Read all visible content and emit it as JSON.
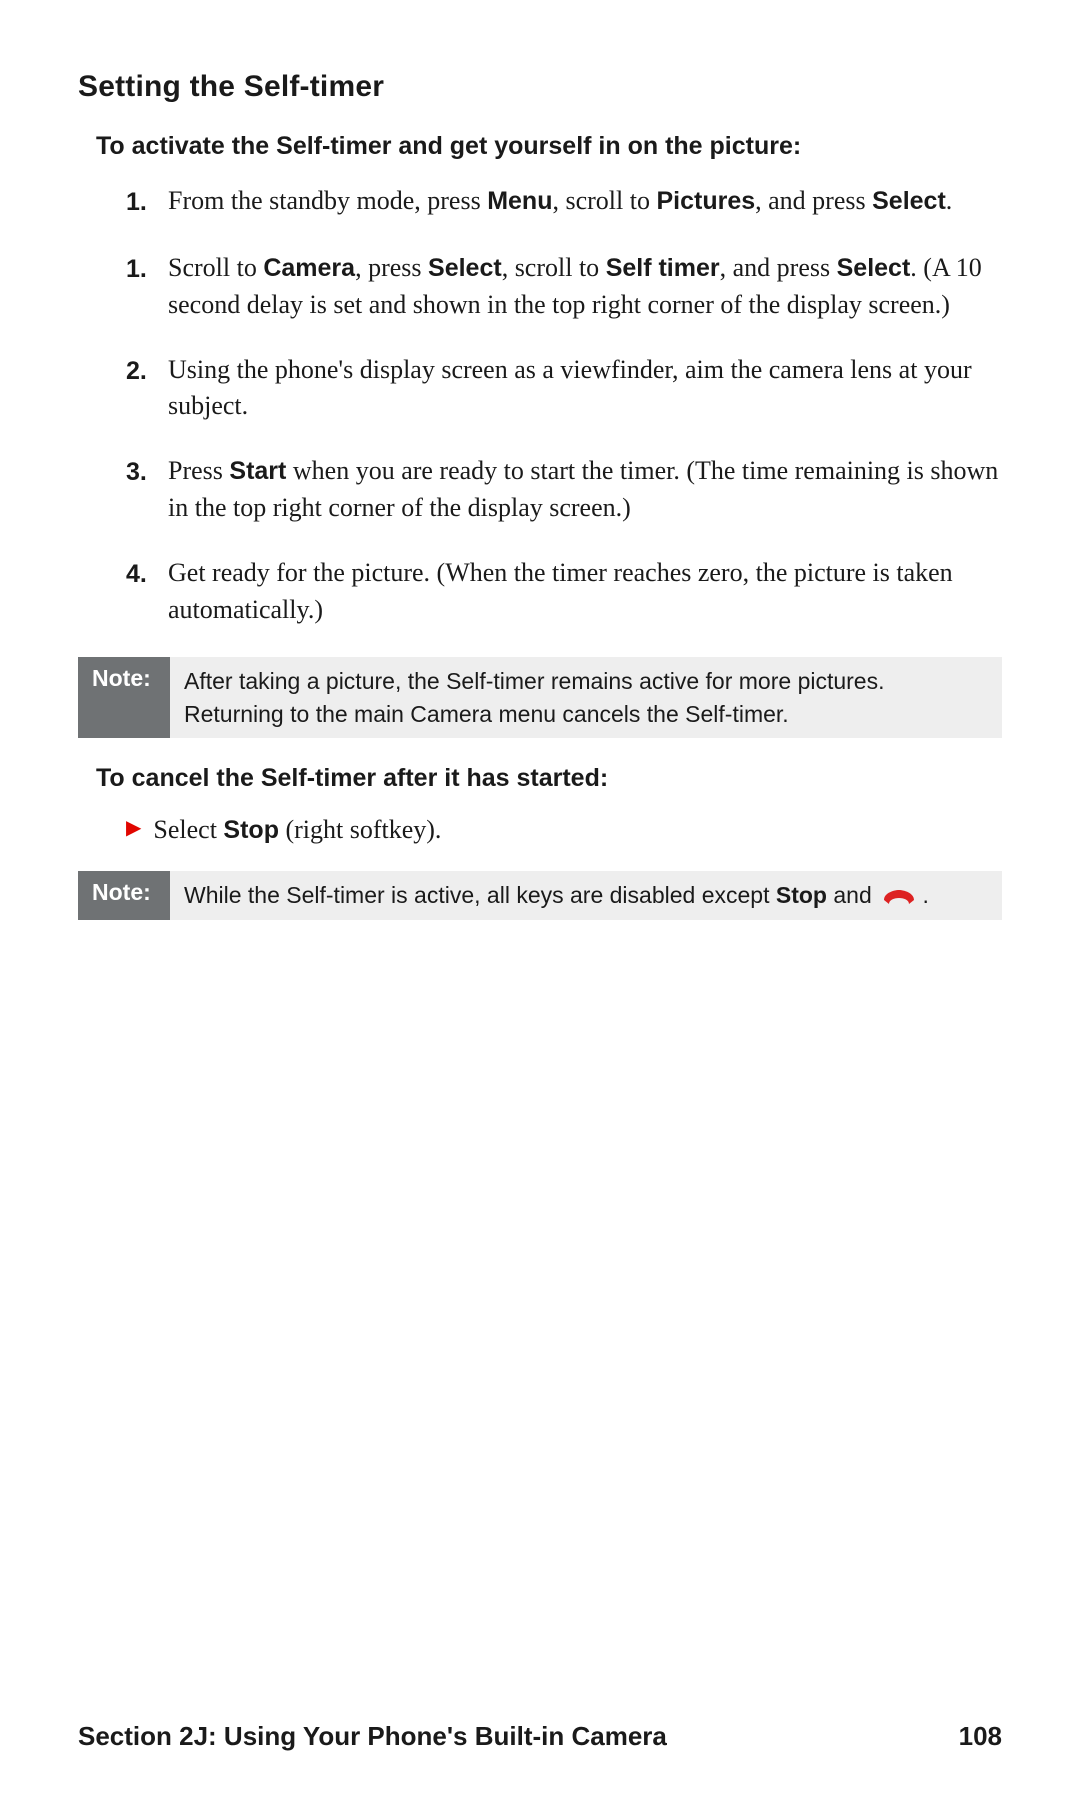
{
  "heading": "Setting the Self-timer",
  "intro": "To activate the Self-timer and get yourself in on the picture:",
  "steps": [
    {
      "num": "1.",
      "parts": [
        {
          "t": "From the standby mode, press "
        },
        {
          "t": "Menu",
          "b": true
        },
        {
          "t": ", scroll to "
        },
        {
          "t": "Pictures",
          "b": true
        },
        {
          "t": ", and press "
        },
        {
          "t": "Select",
          "b": true
        },
        {
          "t": "."
        }
      ]
    },
    {
      "num": "1.",
      "parts": [
        {
          "t": "Scroll to "
        },
        {
          "t": "Camera",
          "b": true
        },
        {
          "t": ", press "
        },
        {
          "t": "Select",
          "b": true
        },
        {
          "t": ", scroll to "
        },
        {
          "t": "Self timer",
          "b": true
        },
        {
          "t": ", and press "
        },
        {
          "t": "Select",
          "b": true
        },
        {
          "t": ". (A 10 second delay is set and shown in the top right corner of the display screen.)"
        }
      ]
    },
    {
      "num": "2.",
      "parts": [
        {
          "t": "Using the phone's display screen as a viewfinder, aim the camera lens at your subject."
        }
      ]
    },
    {
      "num": "3.",
      "parts": [
        {
          "t": "Press "
        },
        {
          "t": "Start",
          "b": true
        },
        {
          "t": " when you are ready to start the timer. (The time remaining is shown in the top right corner of the display screen.)"
        }
      ]
    },
    {
      "num": "4.",
      "parts": [
        {
          "t": "Get ready for the picture. (When the timer reaches zero, the picture is taken automatically.)"
        }
      ]
    }
  ],
  "note1": {
    "label": "Note:",
    "text": "After taking a picture, the Self-timer remains active for more pictures. Returning to the main Camera menu cancels the Self-timer."
  },
  "subhead": "To cancel the Self-timer after it has started:",
  "bullet": {
    "parts": [
      {
        "t": "Select "
      },
      {
        "t": "Stop",
        "b": true
      },
      {
        "t": " (right softkey)."
      }
    ]
  },
  "note2": {
    "label": "Note:",
    "parts": [
      {
        "t": "While the Self-timer is active, all keys are disabled except "
      },
      {
        "t": "Stop",
        "b": true
      },
      {
        "t": " and "
      }
    ],
    "end_icon": "end-call-icon",
    "tail": " ."
  },
  "footer": {
    "section": "Section 2J: Using Your Phone's Built-in Camera",
    "page": "108"
  }
}
